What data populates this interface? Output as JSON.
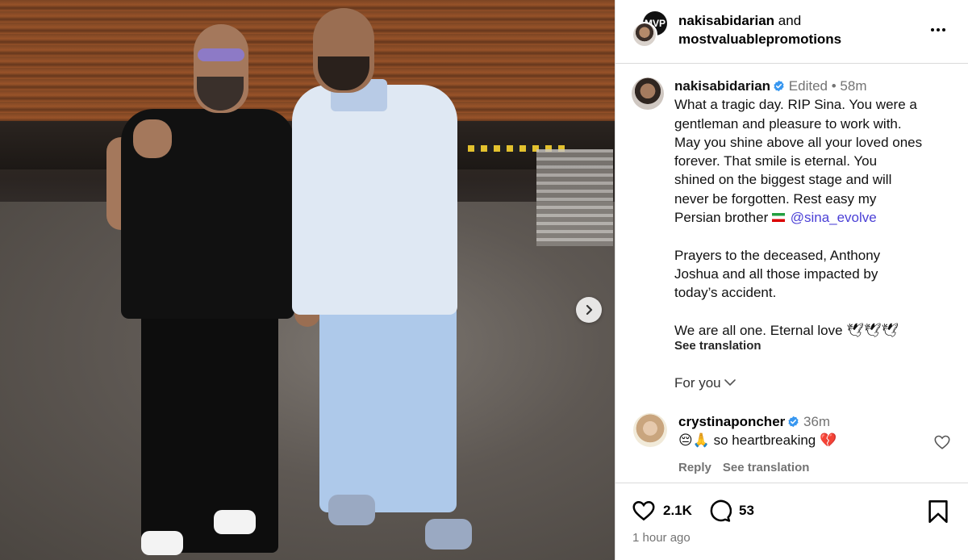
{
  "header": {
    "user1": "nakisabidarian",
    "joiner": " and",
    "user2": "mostvaluablepromotions",
    "avatar_badge": "MVP"
  },
  "post": {
    "username": "nakisabidarian",
    "edited": "Edited",
    "time": "58m",
    "caption_lines": [
      "What a tragic day. RIP Sina. You were a",
      "gentleman and pleasure to work with.",
      "May you shine above all your loved ones",
      "forever. That smile is eternal.  You",
      "shined on the biggest stage and will",
      "never be forgotten. Rest easy my"
    ],
    "persian_line": "Persian brother",
    "mention": "@sina_evolve",
    "para2_lines": [
      "Prayers to the deceased, Anthony",
      "Joshua and all those impacted by",
      "today’s accident."
    ],
    "para3": "We are all one. Eternal love 🕊🕊🕊",
    "see_translation": "See translation",
    "for_you": "For you"
  },
  "comment": {
    "username": "crystinaponcher",
    "time": "36m",
    "text": "😔🙏 so heartbreaking 💔",
    "reply": "Reply",
    "see_translation": "See translation"
  },
  "actions": {
    "likes": "2.1K",
    "comments": "53",
    "time_ago": "1 hour ago"
  },
  "colors": {
    "mention": "#4a3fd6",
    "verified": "#3897f0",
    "muted": "#737373"
  }
}
